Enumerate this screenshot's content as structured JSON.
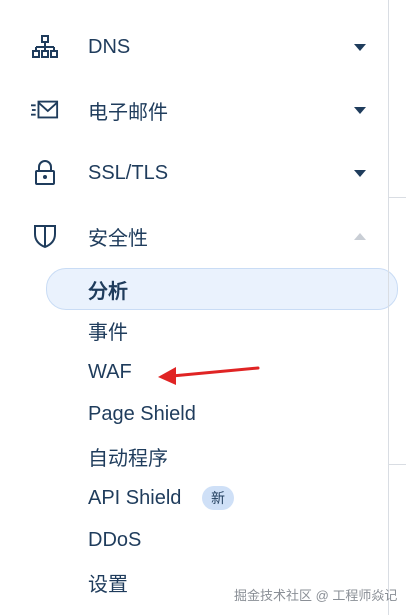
{
  "nav": {
    "items": [
      {
        "label": "DNS",
        "icon": "network-icon",
        "caret": "down"
      },
      {
        "label": "电子邮件",
        "icon": "email-icon",
        "caret": "down"
      },
      {
        "label": "SSL/TLS",
        "icon": "lock-icon",
        "caret": "down"
      },
      {
        "label": "安全性",
        "icon": "shield-icon",
        "caret": "up"
      }
    ],
    "security_subitems": [
      {
        "label": "分析",
        "active": true
      },
      {
        "label": "事件"
      },
      {
        "label": "WAF"
      },
      {
        "label": "Page Shield"
      },
      {
        "label": "自动程序"
      },
      {
        "label": "API Shield",
        "badge": "新"
      },
      {
        "label": "DDoS"
      },
      {
        "label": "设置"
      }
    ]
  },
  "annotation": {
    "target": "WAF",
    "color": "#e02424"
  },
  "watermark": "掘金技术社区 @ 工程师焱记",
  "colors": {
    "text": "#1f3c5c",
    "icon": "#1f3c5c",
    "accent_bg": "#eaf2fd",
    "badge_bg": "#cfe0f7"
  }
}
